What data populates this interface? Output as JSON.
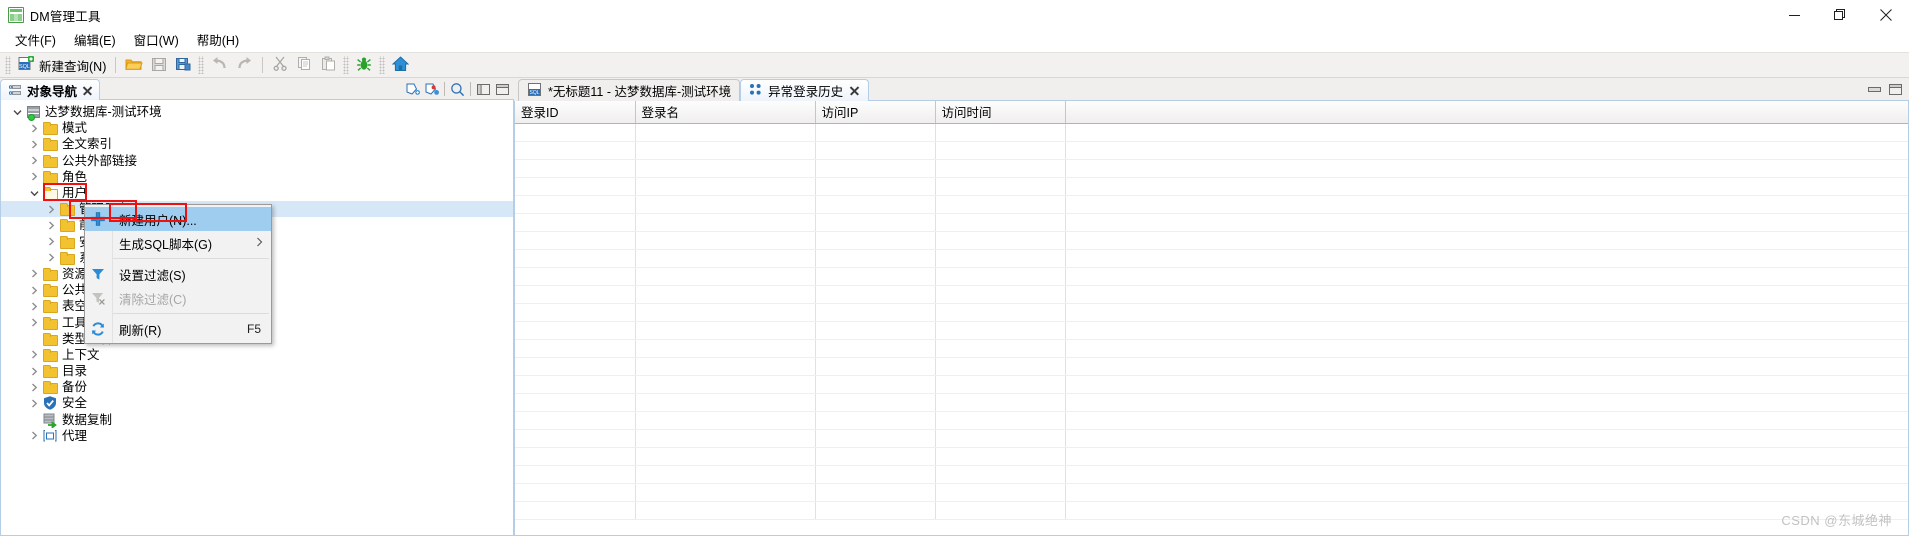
{
  "window": {
    "title": "DM管理工具",
    "icon": "dm-app-icon",
    "controls": {
      "minimize": "minimize-icon",
      "maximize": "restore-icon",
      "close": "close-icon"
    }
  },
  "menubar": {
    "items": [
      {
        "label": "文件(F)",
        "name": "menu-file"
      },
      {
        "label": "编辑(E)",
        "name": "menu-edit"
      },
      {
        "label": "窗口(W)",
        "name": "menu-window"
      },
      {
        "label": "帮助(H)",
        "name": "menu-help"
      }
    ]
  },
  "toolbar": {
    "new_query_label": "新建查询(N)",
    "buttons": [
      {
        "name": "new-query-button",
        "icon": "sql-new-icon",
        "label": "新建查询(N)"
      },
      {
        "name": "open-button",
        "icon": "folder-open-icon",
        "label": ""
      },
      {
        "name": "save-button",
        "icon": "save-icon",
        "label": ""
      },
      {
        "name": "save-as-button",
        "icon": "save-as-icon",
        "label": ""
      },
      {
        "name": "undo-button",
        "icon": "undo-icon",
        "label": ""
      },
      {
        "name": "redo-button",
        "icon": "redo-icon",
        "label": ""
      },
      {
        "name": "cut-button",
        "icon": "scissors-icon",
        "label": ""
      },
      {
        "name": "copy-button",
        "icon": "copy-icon",
        "label": ""
      },
      {
        "name": "paste-button",
        "icon": "paste-icon",
        "label": ""
      },
      {
        "name": "debug-button",
        "icon": "bug-icon",
        "label": ""
      },
      {
        "name": "home-button",
        "icon": "home-icon",
        "label": ""
      }
    ]
  },
  "navigator": {
    "tab_label": "对象导航",
    "tab_icon": "object-navigator-icon",
    "tools": [
      {
        "name": "connect-icon"
      },
      {
        "name": "disconnect-icon"
      },
      {
        "name": "search-icon"
      },
      {
        "name": "minimize-view-icon"
      },
      {
        "name": "maximize-view-icon"
      }
    ],
    "tree": [
      {
        "label": "达梦数据库-测试环境",
        "indent": 0,
        "icon": "database-icon",
        "expanded": true,
        "twisty": "down"
      },
      {
        "label": "模式",
        "indent": 1,
        "icon": "folder-icon",
        "expanded": false,
        "twisty": "right"
      },
      {
        "label": "全文索引",
        "indent": 1,
        "icon": "folder-icon",
        "expanded": false,
        "twisty": "right"
      },
      {
        "label": "公共外部链接",
        "indent": 1,
        "icon": "folder-icon",
        "expanded": false,
        "twisty": "right"
      },
      {
        "label": "角色",
        "indent": 1,
        "icon": "folder-icon",
        "expanded": false,
        "twisty": "right"
      },
      {
        "label": "用户",
        "indent": 1,
        "icon": "folder-open-icon",
        "expanded": true,
        "twisty": "down",
        "annotated": true
      },
      {
        "label": "管理用户",
        "indent": 2,
        "icon": "folder-icon",
        "expanded": false,
        "twisty": "right",
        "selected": true,
        "annotated": true
      },
      {
        "label": "前",
        "indent": 2,
        "icon": "folder-icon",
        "expanded": false,
        "twisty": "right"
      },
      {
        "label": "安",
        "indent": 2,
        "icon": "folder-icon",
        "expanded": false,
        "twisty": "right"
      },
      {
        "label": "系",
        "indent": 2,
        "icon": "folder-icon",
        "expanded": false,
        "twisty": "right"
      },
      {
        "label": "资源",
        "indent": 1,
        "icon": "folder-icon",
        "expanded": false,
        "twisty": "right"
      },
      {
        "label": "公共",
        "indent": 1,
        "icon": "folder-icon",
        "expanded": false,
        "twisty": "right"
      },
      {
        "label": "表空",
        "indent": 1,
        "icon": "folder-icon",
        "expanded": false,
        "twisty": "right"
      },
      {
        "label": "工具包",
        "indent": 1,
        "icon": "folder-icon",
        "expanded": false,
        "twisty": "right"
      },
      {
        "label": "类型别名",
        "indent": 1,
        "icon": "folder-icon",
        "expanded": false,
        "twisty": "none"
      },
      {
        "label": "上下文",
        "indent": 1,
        "icon": "folder-icon",
        "expanded": false,
        "twisty": "right"
      },
      {
        "label": "目录",
        "indent": 1,
        "icon": "folder-icon",
        "expanded": false,
        "twisty": "right"
      },
      {
        "label": "备份",
        "indent": 1,
        "icon": "folder-icon",
        "expanded": false,
        "twisty": "right"
      },
      {
        "label": "安全",
        "indent": 1,
        "icon": "shield-icon",
        "expanded": false,
        "twisty": "right"
      },
      {
        "label": "数据复制",
        "indent": 1,
        "icon": "replication-icon",
        "expanded": false,
        "twisty": "none"
      },
      {
        "label": "代理",
        "indent": 1,
        "icon": "agent-icon",
        "expanded": false,
        "twisty": "right"
      }
    ]
  },
  "context_menu": {
    "items": [
      {
        "label": "新建用户(N)...",
        "icon": "plus-icon",
        "accel": "",
        "state": "highlight",
        "submenu": false
      },
      {
        "label": "生成SQL脚本(G)",
        "icon": "",
        "accel": "",
        "state": "normal",
        "submenu": true
      },
      {
        "label": "设置过滤(S)",
        "icon": "filter-icon",
        "accel": "",
        "state": "normal",
        "submenu": false
      },
      {
        "label": "清除过滤(C)",
        "icon": "filter-clear-icon",
        "accel": "",
        "state": "disabled",
        "submenu": false
      },
      {
        "label": "刷新(R)",
        "icon": "refresh-icon",
        "accel": "F5",
        "state": "normal",
        "submenu": false
      }
    ]
  },
  "editor": {
    "tabs": [
      {
        "label": "*无标题11 - 达梦数据库-测试环境",
        "icon": "sql-file-icon",
        "active": false,
        "closable": false
      },
      {
        "label": "异常登录历史",
        "icon": "login-history-icon",
        "active": true,
        "closable": true
      }
    ],
    "corner_tools": [
      {
        "name": "minimize-editor-icon"
      },
      {
        "name": "maximize-editor-icon"
      }
    ],
    "table": {
      "columns": [
        "登录ID",
        "登录名",
        "访问IP",
        "访问时间"
      ],
      "rows": []
    }
  },
  "watermark": {
    "text": "CSDN @东城绝神"
  },
  "colors": {
    "folder": "#f2c230",
    "accent_blue": "#0a74c8",
    "selection": "#d6e8f7",
    "menu_highlight": "#9ecdf0",
    "annotation_red": "#ee1111",
    "tab_border": "#b6cee5"
  }
}
